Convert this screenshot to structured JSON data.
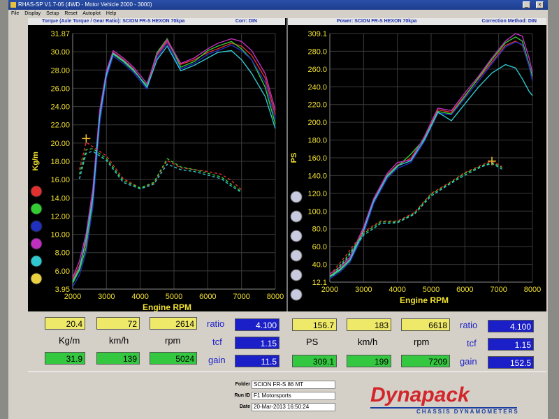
{
  "window": {
    "title": "RHAS-SP V1.7-05  (4WD - Motor Vehicle 2000 - 3000)",
    "menu": [
      "File",
      "Display",
      "Setup",
      "Reset",
      "Autoplot",
      "Help"
    ]
  },
  "torque_graph": {
    "header_left": "Torque (Axle Torque / Gear Ratio): SCION FR-S HEXON 70kpa",
    "header_right": "Corr: DIN"
  },
  "power_graph": {
    "header_left": "Power: SCION FR-S HEXON 70kpa",
    "header_right": "Correction Method: DIN"
  },
  "run_colors": [
    "#e03030",
    "#33cc33",
    "#2030c0",
    "#c030c0",
    "#30c8d0",
    "#e8d040"
  ],
  "chart_data": [
    {
      "type": "line",
      "xlabel": "Engine RPM",
      "ylabel": "Kg/m",
      "xlim": [
        2000,
        8000
      ],
      "ylim": [
        3.95,
        31.87
      ],
      "x_ticks": [
        "2000",
        "3000",
        "4000",
        "5000",
        "6000",
        "7000",
        "8000"
      ],
      "y_ticks": [
        "31.87",
        "30.00",
        "28.00",
        "26.00",
        "24.00",
        "22.00",
        "20.00",
        "18.00",
        "16.00",
        "14.00",
        "12.00",
        "10.00",
        "8.00",
        "6.00",
        "3.95"
      ],
      "grid": true,
      "marker": {
        "x": 2400,
        "y": 20.4
      },
      "series": [
        {
          "color": "#e03030",
          "x": [
            2000,
            2200,
            2400,
            2600,
            2800,
            3000,
            3200,
            3500,
            3800,
            4200,
            4500,
            4800,
            5200,
            5600,
            6000,
            6300,
            6700,
            7000,
            7300,
            7700,
            8000
          ],
          "y": [
            5.0,
            6.5,
            9.0,
            14.5,
            23.0,
            27.5,
            29.8,
            29.0,
            28.0,
            26.0,
            29.5,
            31.0,
            28.5,
            29.0,
            29.8,
            30.2,
            30.8,
            30.5,
            29.5,
            27.0,
            23.0
          ]
        },
        {
          "color": "#33cc33",
          "x": [
            2000,
            2200,
            2400,
            2600,
            2800,
            3000,
            3200,
            3500,
            3800,
            4200,
            4500,
            4800,
            5200,
            5600,
            6000,
            6300,
            6700,
            7000,
            7300,
            7700,
            8000
          ],
          "y": [
            4.6,
            6.0,
            8.5,
            13.5,
            22.5,
            27.2,
            29.6,
            28.8,
            27.8,
            26.2,
            29.8,
            31.3,
            28.2,
            28.8,
            30.0,
            30.5,
            31.0,
            30.2,
            29.0,
            26.0,
            22.0
          ]
        },
        {
          "color": "#2030c0",
          "x": [
            2000,
            2200,
            2400,
            2600,
            2800,
            3000,
            3200,
            3500,
            3800,
            4200,
            4500,
            4800,
            5200,
            5600,
            6000,
            6300,
            6700,
            7000,
            7300,
            7700,
            8000
          ],
          "y": [
            4.2,
            5.5,
            8.0,
            13.0,
            22.0,
            27.0,
            29.4,
            28.6,
            27.6,
            25.8,
            29.2,
            30.8,
            28.0,
            28.6,
            29.6,
            30.0,
            30.6,
            30.0,
            29.0,
            26.5,
            22.5
          ]
        },
        {
          "color": "#c030c0",
          "x": [
            2000,
            2200,
            2400,
            2600,
            2800,
            3000,
            3200,
            3500,
            3800,
            4200,
            4500,
            4800,
            5200,
            5600,
            6000,
            6300,
            6700,
            7000,
            7300,
            7700,
            8000
          ],
          "y": [
            5.2,
            7.0,
            10.0,
            15.0,
            23.5,
            27.8,
            30.0,
            29.2,
            28.2,
            26.4,
            29.6,
            31.2,
            28.6,
            29.2,
            30.2,
            30.8,
            31.3,
            31.0,
            30.0,
            27.5,
            23.5
          ]
        },
        {
          "color": "#30c8d0",
          "x": [
            2000,
            2200,
            2400,
            2600,
            2800,
            3000,
            3200,
            3500,
            3800,
            4200,
            4500,
            4800,
            5200,
            5600,
            6000,
            6300,
            6700,
            7000,
            7300,
            7700,
            8000
          ],
          "y": [
            4.8,
            6.2,
            9.5,
            14.0,
            22.8,
            27.4,
            29.7,
            28.9,
            27.9,
            26.0,
            29.0,
            30.5,
            27.8,
            28.4,
            29.2,
            29.8,
            30.0,
            29.0,
            27.5,
            25.0,
            21.5
          ]
        },
        {
          "color": "#e03030",
          "dashed": true,
          "x": [
            2200,
            2400,
            2600,
            3000,
            3500,
            4000,
            4400,
            4800,
            5200,
            5600,
            6000,
            6400,
            6700,
            7000
          ],
          "y": [
            17.0,
            20.0,
            19.5,
            18.5,
            16.0,
            15.0,
            15.5,
            18.0,
            17.2,
            17.0,
            16.8,
            16.5,
            15.8,
            14.8
          ]
        },
        {
          "color": "#33cc33",
          "dashed": true,
          "x": [
            2200,
            2400,
            2600,
            3000,
            3500,
            4000,
            4400,
            4800,
            5200,
            5600,
            6000,
            6400,
            6700,
            7000
          ],
          "y": [
            16.5,
            19.2,
            19.3,
            18.2,
            15.8,
            15.0,
            15.6,
            18.2,
            17.3,
            17.0,
            16.6,
            16.2,
            15.4,
            14.6
          ]
        },
        {
          "color": "#30c8d0",
          "dashed": true,
          "x": [
            2200,
            2400,
            2600,
            3000,
            3500,
            4000,
            4400,
            4800,
            5200,
            5600,
            6000,
            6400,
            6700,
            7000
          ],
          "y": [
            16.0,
            18.8,
            19.0,
            18.0,
            15.6,
            14.9,
            15.4,
            17.6,
            17.0,
            16.8,
            16.4,
            16.0,
            15.2,
            14.5
          ]
        }
      ]
    },
    {
      "type": "line",
      "xlabel": "Engine RPM",
      "ylabel": "PS",
      "xlim": [
        2000,
        8000
      ],
      "ylim": [
        12.1,
        309.1
      ],
      "x_ticks": [
        "2000",
        "3000",
        "4000",
        "5000",
        "6000",
        "7000",
        "8000"
      ],
      "y_ticks": [
        "309.1",
        "280.0",
        "260.0",
        "240.0",
        "220.0",
        "200.0",
        "180.0",
        "160.0",
        "140.0",
        "120.0",
        "100.0",
        "80.0",
        "60.0",
        "40.0",
        "12.1"
      ],
      "grid": true,
      "marker": {
        "x": 6800,
        "y": 156.7
      },
      "series": [
        {
          "color": "#e03030",
          "x": [
            2000,
            2300,
            2600,
            3000,
            3300,
            3700,
            4000,
            4400,
            4800,
            5200,
            5600,
            6000,
            6400,
            6800,
            7200,
            7500,
            7700,
            7900,
            8000
          ],
          "y": [
            20,
            28,
            40,
            75,
            110,
            140,
            152,
            160,
            185,
            218,
            215,
            235,
            255,
            275,
            295,
            300,
            295,
            270,
            255
          ]
        },
        {
          "color": "#33cc33",
          "x": [
            2000,
            2300,
            2600,
            3000,
            3300,
            3700,
            4000,
            4400,
            4800,
            5200,
            5600,
            6000,
            6400,
            6800,
            7200,
            7500,
            7700,
            7900,
            8000
          ],
          "y": [
            18,
            26,
            38,
            72,
            108,
            138,
            150,
            165,
            183,
            216,
            213,
            234,
            256,
            278,
            298,
            305,
            300,
            272,
            258
          ]
        },
        {
          "color": "#2030c0",
          "x": [
            2000,
            2300,
            2600,
            3000,
            3300,
            3700,
            4000,
            4400,
            4800,
            5200,
            5600,
            6000,
            6400,
            6800,
            7200,
            7500,
            7700,
            7900,
            8000
          ],
          "y": [
            16,
            24,
            36,
            70,
            106,
            136,
            148,
            155,
            180,
            214,
            212,
            232,
            252,
            273,
            293,
            299,
            296,
            270,
            252
          ]
        },
        {
          "color": "#c030c0",
          "x": [
            2000,
            2300,
            2600,
            3000,
            3300,
            3700,
            4000,
            4400,
            4800,
            5200,
            5600,
            6000,
            6400,
            6800,
            7200,
            7500,
            7700,
            7900,
            8000
          ],
          "y": [
            22,
            30,
            42,
            78,
            112,
            142,
            155,
            158,
            186,
            220,
            217,
            238,
            258,
            280,
            300,
            309,
            306,
            280,
            262
          ]
        },
        {
          "color": "#30c8d0",
          "x": [
            2000,
            2300,
            2600,
            3000,
            3300,
            3700,
            4000,
            4400,
            4800,
            5200,
            5600,
            6000,
            6400,
            6800,
            7200,
            7500,
            7700,
            7900,
            8000
          ],
          "y": [
            19,
            27,
            39,
            74,
            109,
            139,
            151,
            157,
            182,
            215,
            205,
            225,
            245,
            262,
            272,
            268,
            255,
            240,
            235
          ]
        },
        {
          "color": "#e03030",
          "dashed": true,
          "x": [
            2100,
            2500,
            3000,
            3500,
            4000,
            4500,
            5000,
            5500,
            6000,
            6500,
            6800,
            7100
          ],
          "y": [
            25,
            45,
            72,
            85,
            85,
            95,
            118,
            130,
            143,
            152,
            157,
            150
          ]
        },
        {
          "color": "#33cc33",
          "dashed": true,
          "x": [
            2100,
            2500,
            3000,
            3500,
            4000,
            4500,
            5000,
            5500,
            6000,
            6500,
            6800,
            7100
          ],
          "y": [
            22,
            42,
            70,
            84,
            84,
            94,
            117,
            129,
            142,
            151,
            155,
            149
          ]
        },
        {
          "color": "#30c8d0",
          "dashed": true,
          "x": [
            2100,
            2500,
            3000,
            3500,
            4000,
            4500,
            5000,
            5500,
            6000,
            6500,
            6800,
            7100
          ],
          "y": [
            20,
            40,
            68,
            82,
            83,
            93,
            115,
            128,
            140,
            150,
            154,
            147
          ]
        }
      ]
    }
  ],
  "torque_readout": {
    "current": {
      "torque": "20.4",
      "speed": "72",
      "rpm": "2614"
    },
    "units": {
      "torque": "Kg/m",
      "speed": "km/h",
      "rpm": "rpm"
    },
    "peak": {
      "torque": "31.9",
      "speed": "139",
      "rpm": "5024"
    },
    "ratio_label": "ratio",
    "ratio": "4.100",
    "tcf_label": "tcf",
    "tcf": "1.15",
    "gain_label": "gain",
    "gain": "11.5"
  },
  "power_readout": {
    "current": {
      "power": "156.7",
      "speed": "183",
      "rpm": "6618"
    },
    "units": {
      "power": "PS",
      "speed": "km/h",
      "rpm": "rpm"
    },
    "peak": {
      "power": "309.1",
      "speed": "199",
      "rpm": "7209"
    },
    "ratio_label": "ratio",
    "ratio": "4.100",
    "tcf_label": "tcf",
    "tcf": "1.15",
    "gain_label": "gain",
    "gain": "152.5"
  },
  "run_info": {
    "folder_label": "Folder",
    "folder": "SCION FR-S 86 MT",
    "runid_label": "Run ID",
    "runid": "F1 Motorsports",
    "date_label": "Date",
    "date": "20-Mar-2013   16:50:24"
  },
  "logo": {
    "name": "Dynapack",
    "tagline": "CHASSIS DYNAMOMETERS"
  }
}
